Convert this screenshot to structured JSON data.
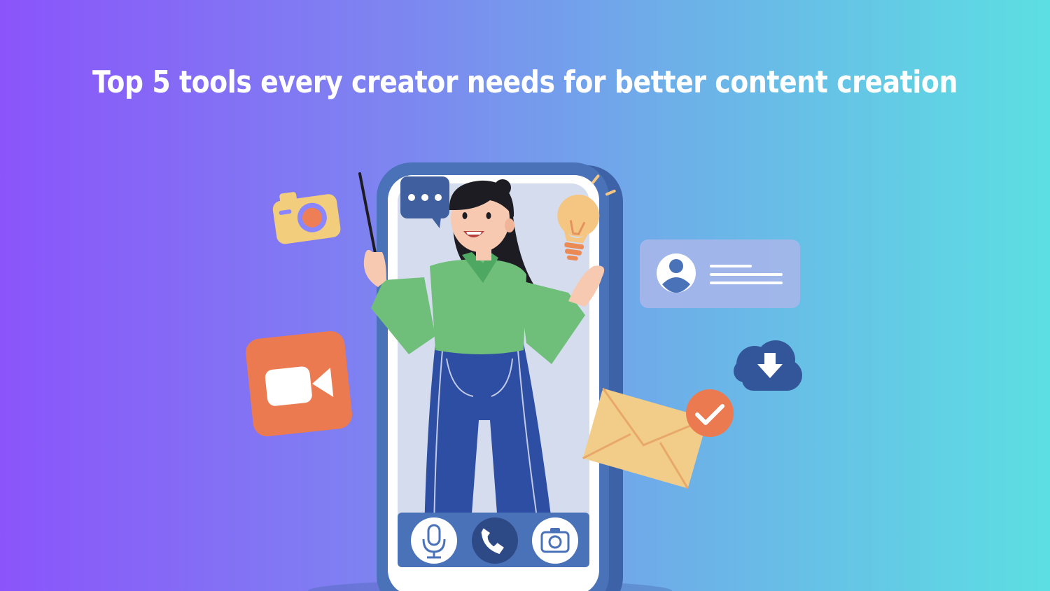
{
  "headline": "Top 5 tools every creator needs for better content creation",
  "colors": {
    "gradient_left": "#8b54fb",
    "gradient_right": "#5cdfe2",
    "phone_frame": "#4a72b8",
    "phone_screen": "#d4dced",
    "shirt": "#6fbf7a",
    "pants": "#2e4ea3",
    "hair": "#1c1c22",
    "video_icon": "#ec7a50",
    "camera_icon": "#f2cd7c",
    "envelope": "#f2cd8a",
    "check_badge": "#ec7a50"
  },
  "icons": [
    "camera-icon",
    "video-camera-icon",
    "chat-bubble-icon",
    "lightbulb-icon",
    "profile-card-icon",
    "cloud-download-icon",
    "envelope-icon",
    "check-icon",
    "microphone-icon",
    "phone-call-icon",
    "phone-camera-icon"
  ]
}
